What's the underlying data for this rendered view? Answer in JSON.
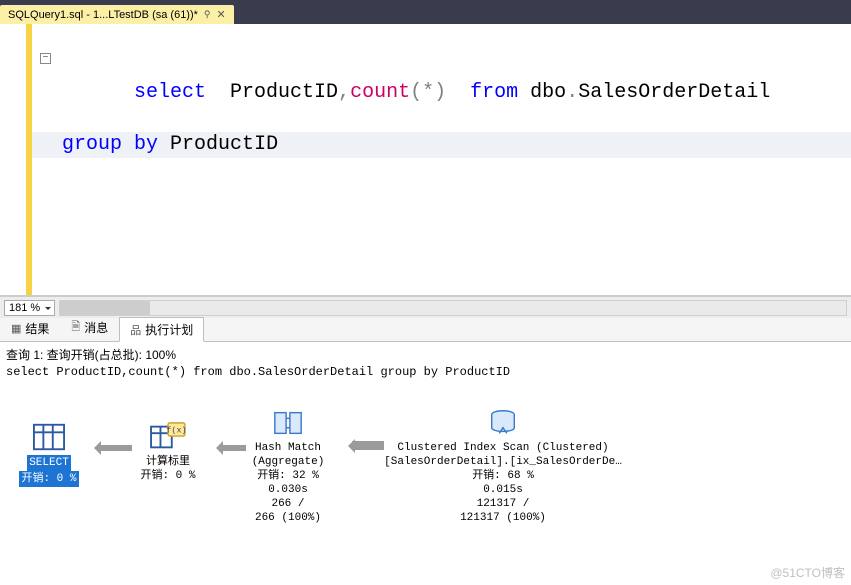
{
  "tab": {
    "title": "SQLQuery1.sql - 1...LTestDB (sa (61))*"
  },
  "editor": {
    "zoom": "181 %",
    "line1": {
      "t1": "select",
      "t2": "  ProductID",
      "t3": ",",
      "t4": "count",
      "t5": "(",
      "t6": "*",
      "t7": ")",
      "t8": "  ",
      "t9": "from",
      "t10": " dbo",
      "t11": ".",
      "t12": "SalesOrderDetail"
    },
    "line2": {
      "t1": "group",
      "t2": " ",
      "t3": "by",
      "t4": " ProductID"
    }
  },
  "resultTabs": {
    "results": "结果",
    "messages": "消息",
    "plan": "执行计划"
  },
  "planHeader": {
    "line1": "查询 1: 查询开销(占总批): 100%",
    "line2": "select ProductID,count(*) from dbo.SalesOrderDetail group by ProductID"
  },
  "nodes": {
    "select": {
      "label": "SELECT",
      "cost": "开销: 0 %"
    },
    "scalar": {
      "label": "计算标里",
      "cost": "开销: 0 %"
    },
    "hash": {
      "label": "Hash Match",
      "sub": "(Aggregate)",
      "cost": "开销: 32 %",
      "time": "0.030s",
      "rows1": "266 /",
      "rows2": "266 (100%)"
    },
    "scan": {
      "label": "Clustered Index Scan (Clustered)",
      "sub": "[SalesOrderDetail].[ix_SalesOrderDe…",
      "cost": "开销: 68 %",
      "time": "0.015s",
      "rows1": "121317 /",
      "rows2": "121317 (100%)"
    }
  },
  "watermark": "@51CTO博客"
}
